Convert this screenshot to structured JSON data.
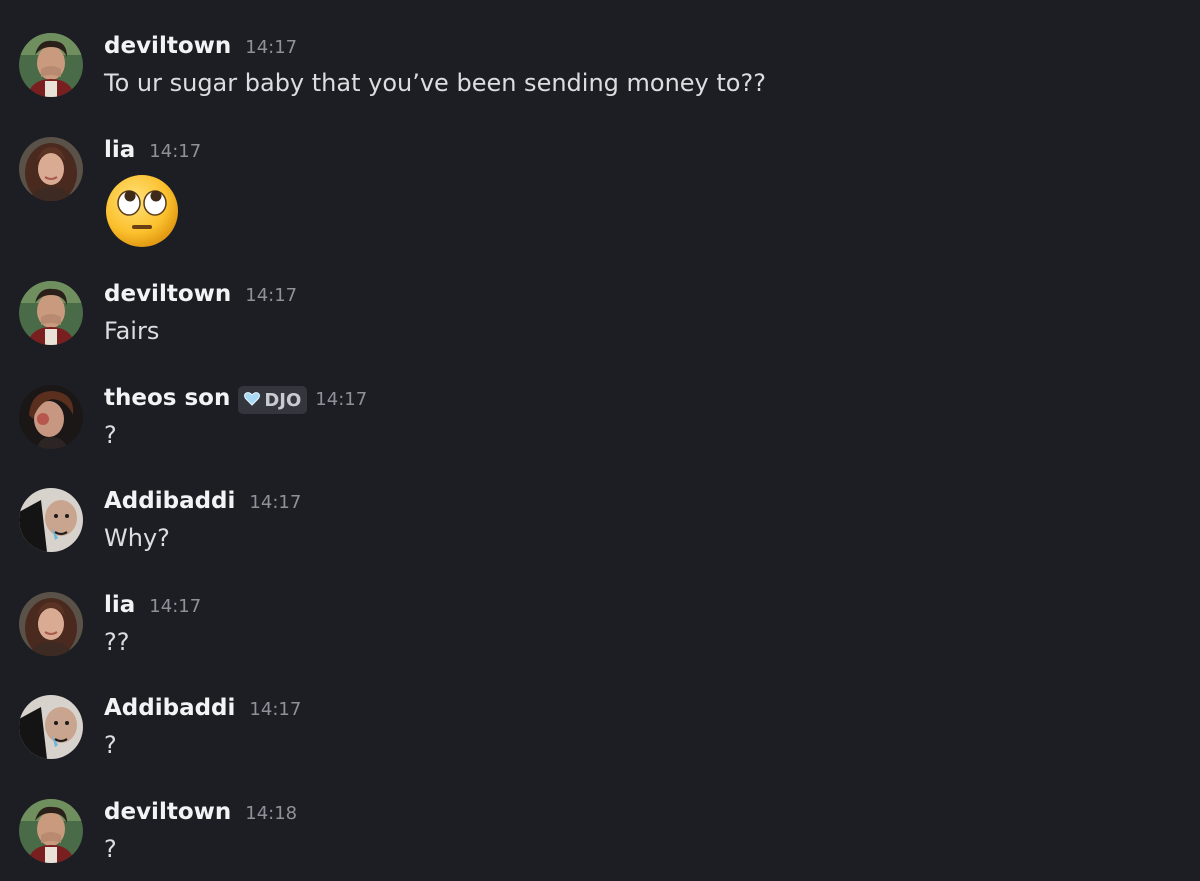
{
  "messages": [
    {
      "author": "deviltown",
      "time": "14:17",
      "text": "To ur sugar baby that you’ve been sending money to??",
      "avatar": "deviltown-avatar"
    },
    {
      "author": "lia",
      "time": "14:17",
      "emoji": "face-with-rolling-eyes",
      "avatar": "lia-avatar"
    },
    {
      "author": "deviltown",
      "time": "14:17",
      "text": "Fairs",
      "avatar": "deviltown-avatar"
    },
    {
      "author": "theos son",
      "time": "14:17",
      "tag": "DJO",
      "tag_icon": "light-blue-heart-icon",
      "text": "?",
      "avatar": "theos-son-avatar"
    },
    {
      "author": "Addibaddi",
      "time": "14:17",
      "text": "Why?",
      "avatar": "addibaddi-avatar"
    },
    {
      "author": "lia",
      "time": "14:17",
      "text": "??",
      "avatar": "lia-avatar"
    },
    {
      "author": "Addibaddi",
      "time": "14:17",
      "text": "?",
      "avatar": "addibaddi-avatar"
    },
    {
      "author": "deviltown",
      "time": "14:18",
      "text": "?",
      "avatar": "deviltown-avatar"
    }
  ],
  "colors": {
    "background": "#1d1e23",
    "username": "#f2f3f5",
    "timestamp": "#8e9199",
    "message_text": "#dbdee1",
    "tag_background": "#34363d"
  }
}
